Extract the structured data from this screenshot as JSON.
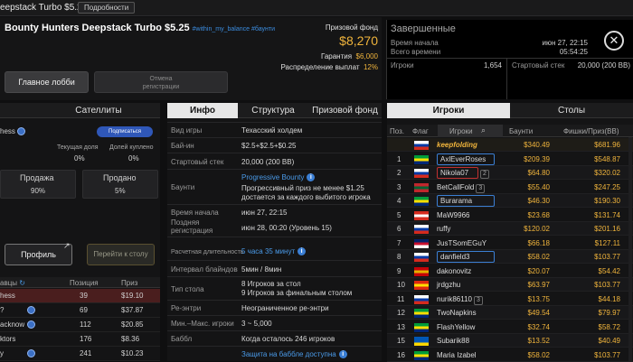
{
  "window": {
    "title": "eepstack Turbo $5.25",
    "details": "Подробности"
  },
  "header": {
    "name": "Bounty Hunters Deepstack Turbo $5.25",
    "tags": "#within_my_balance #баунти",
    "prize_label": "Призовой фонд",
    "prize_value": "$8,270",
    "guarantee_label": "Гарантия",
    "guarantee_value": "$6,000",
    "dist_label": "Распределение выплат",
    "dist_value": "12%",
    "lobby_button": "Главное лобби",
    "unreg_line1": "Отмена",
    "unreg_line2": "регистрации"
  },
  "status": {
    "title": "Завершенные",
    "start_label": "Время начала",
    "start_value": "июн 27, 22:15",
    "total_label": "Всего времени",
    "total_value": "05:54:25",
    "players_label": "Игроки",
    "players_value": "1,654",
    "stack_label": "Стартовый стек",
    "stack_value": "20,000 (200 BB)"
  },
  "left": {
    "tab_satellites": "Сателлиты",
    "name_fragment": "hess",
    "subscribe": "Подписаться",
    "share_label": "Текущая доля",
    "share_value": "0%",
    "bought_label": "Долей куплено",
    "bought_value": "0%",
    "sale_label": "Продажа",
    "sale_value": "90%",
    "sold_label": "Продано",
    "sold_value": "5%",
    "profile_button": "Профиль",
    "go_table_button": "Перейти к столу",
    "list_headers": {
      "name": "авцы",
      "position": "Позиция",
      "prize": "Приз"
    },
    "list": [
      {
        "name": "hess",
        "pos": "39",
        "prize": "$19.10"
      },
      {
        "name": "?",
        "pos": "69",
        "prize": "$37.87"
      },
      {
        "name": "acknow",
        "pos": "112",
        "prize": "$20.85"
      },
      {
        "name": "ktors",
        "pos": "176",
        "prize": "$8.36"
      },
      {
        "name": "y",
        "pos": "241",
        "prize": "$10.23"
      }
    ]
  },
  "mid": {
    "tab_info": "Инфо",
    "tab_structure": "Структура",
    "tab_prize": "Призовой фонд",
    "rows": {
      "game_label": "Вид игры",
      "game_value": "Техасский холдем",
      "buyin_label": "Бай-ин",
      "buyin_value": "$2.5+$2.5+$0.25",
      "stack_label": "Стартовый стек",
      "stack_value": "20,000 (200 BB)",
      "bounty_label": "Баунти",
      "bounty_title": "Progressive Bounty",
      "bounty_desc1": "Прогрессивный приз не менее $1.25",
      "bounty_desc2": "достается за каждого выбитого игрока",
      "start_label": "Время начала",
      "start_value": "июн 27, 22:15",
      "latereg_label1": "Поздняя",
      "latereg_label2": "регистрация",
      "latereg_value": "июн 28, 00:20 (Уровень 15)",
      "duration_label": "Расчетная длительность",
      "duration_value": "5 часа 35 минут",
      "blinds_label": "Интервал блайндов",
      "blinds_value": "5мин / 8мин",
      "tabletype_label": "Тип стола",
      "tabletype_value1": "8 Игроков за стол",
      "tabletype_value2": "9 Игроков за финальным столом",
      "reentry_label": "Ре-энтри",
      "reentry_value": "Неограниченное ре-энтри",
      "minmax_label": "Мин.–Макс. игроки",
      "minmax_value": "3 ~ 5,000",
      "bubble_label": "Баббл",
      "bubble_value": "Когда осталось 246 игроков",
      "bubble_protect": "Защита на баббле доступна"
    }
  },
  "right": {
    "tab_players": "Игроки",
    "tab_tables": "Столы",
    "headers": {
      "pos": "Поз.",
      "flag": "Флаг",
      "players": "Игроки",
      "bounty": "Баунти",
      "chips": "Фишки/Приз(BB)"
    },
    "players": [
      {
        "pos": "",
        "name": "keepfolding",
        "bounty": "$340.49",
        "chips": "$681.96",
        "style": "gold"
      },
      {
        "pos": "1",
        "name": "AxlEverRoses",
        "bounty": "$209.39",
        "chips": "$548.87",
        "style": "box"
      },
      {
        "pos": "2",
        "name": "Nikola07",
        "bounty": "$64.80",
        "chips": "$320.02",
        "style": "box2",
        "badge": "2"
      },
      {
        "pos": "3",
        "name": "BetCallFold",
        "bounty": "$55.40",
        "chips": "$247.25",
        "style": "plain",
        "badge": "3"
      },
      {
        "pos": "4",
        "name": "Burarama",
        "bounty": "$46.30",
        "chips": "$190.30",
        "style": "box"
      },
      {
        "pos": "5",
        "name": "MaW9966",
        "bounty": "$23.68",
        "chips": "$131.74",
        "style": "plain"
      },
      {
        "pos": "6",
        "name": "ruffy",
        "bounty": "$120.02",
        "chips": "$201.16",
        "style": "plain"
      },
      {
        "pos": "7",
        "name": "JusTSomEGuY",
        "bounty": "$66.18",
        "chips": "$127.11",
        "style": "plain"
      },
      {
        "pos": "8",
        "name": "danfield3",
        "bounty": "$58.02",
        "chips": "$103.77",
        "style": "box"
      },
      {
        "pos": "9",
        "name": "dakonovitz",
        "bounty": "$20.07",
        "chips": "$54.42",
        "style": "plain"
      },
      {
        "pos": "10",
        "name": "jrdgzhu",
        "bounty": "$63.97",
        "chips": "$103.77",
        "style": "plain"
      },
      {
        "pos": "11",
        "name": "nurik86110",
        "bounty": "$13.75",
        "chips": "$44.18",
        "style": "plain",
        "badge": "3"
      },
      {
        "pos": "12",
        "name": "TwoNapkins",
        "bounty": "$49.54",
        "chips": "$79.97",
        "style": "plain"
      },
      {
        "pos": "13",
        "name": "FlashYellow",
        "bounty": "$32.74",
        "chips": "$58.72",
        "style": "plain"
      },
      {
        "pos": "15",
        "name": "Subarik88",
        "bounty": "$13.52",
        "chips": "$40.49",
        "style": "plain"
      },
      {
        "pos": "16",
        "name": "Maria Izabel",
        "bounty": "$58.02",
        "chips": "$103.77",
        "style": "plain"
      }
    ]
  },
  "colors": {
    "accent": "#f0b43c",
    "link": "#4a9ae8",
    "bg": "#0f0f10"
  }
}
